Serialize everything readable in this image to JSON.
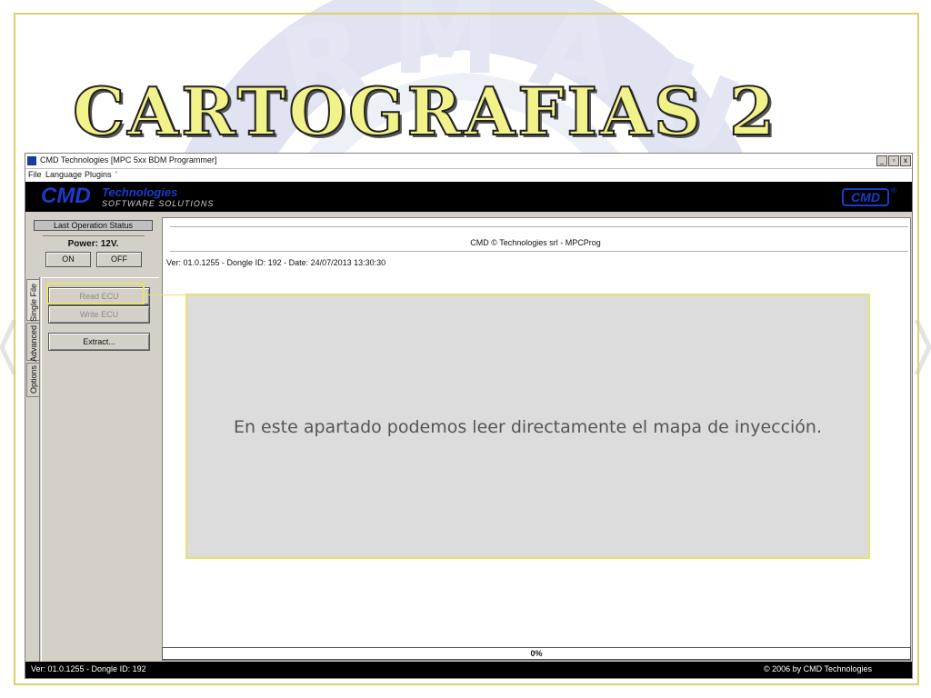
{
  "slide": {
    "title": "Cartografias 2",
    "callout_text": "En este apartado podemos leer directamente el mapa de inyección."
  },
  "window": {
    "title": "CMD Technologies [MPC 5xx BDM Programmer]",
    "controls": [
      "_",
      "▫",
      "x"
    ]
  },
  "menu": {
    "items": [
      "File",
      "Language",
      "Plugins",
      "'"
    ]
  },
  "banner": {
    "brand": "CMD",
    "tagline": "Technologies",
    "subtitle": "SOFTWARE SOLUTIONS",
    "logo": "CMD",
    "logo_mark": "®"
  },
  "left_panel": {
    "status_label": "Last Operation Status",
    "power_label": "Power: 12V.",
    "on_button": "ON",
    "off_button": "OFF",
    "tabs": [
      "Single File",
      "Advanced",
      "Options"
    ],
    "read_button": "Read ECU",
    "write_button": "Write ECU",
    "extract_button": "Extract..."
  },
  "main": {
    "header": "CMD © Technologies srl - MPCProg",
    "version_line": "Ver: 01.0.1255 - Dongle ID: 192 - Date: 24/07/2013 13:30:30"
  },
  "progress": {
    "value": 0,
    "label": "0%"
  },
  "statusbar": {
    "left": "Ver: 01.0.1255 - Dongle ID: 192",
    "right": "© 2006 by CMD Technologies"
  },
  "colors": {
    "accent_yellow": "#e6e46e",
    "brand_blue": "#1a3cc8",
    "title_fill": "#f2f28a"
  }
}
